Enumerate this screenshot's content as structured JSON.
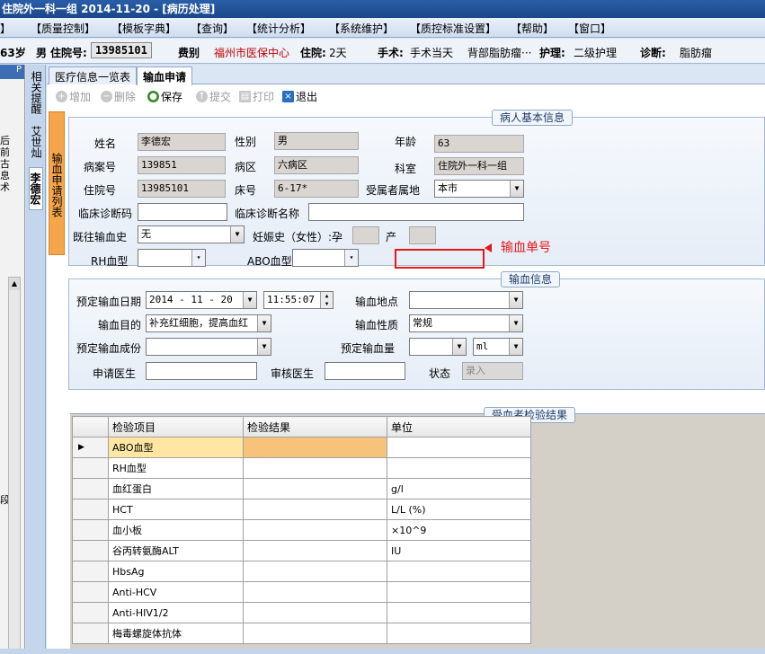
{
  "window": {
    "title": "住院外一科一组  2014-11-20 - [病历处理]"
  },
  "menu": [
    "】",
    "【质量控制】",
    "【模板字典】",
    "【查询】",
    "【统计分析】",
    "【系统维护】",
    "【质控标准设置】",
    "【帮助】",
    "【窗口】"
  ],
  "patient_bar": {
    "age": "63岁",
    "sex": "男",
    "hosp_no_label": "住院号:",
    "hosp_no": "13985101",
    "fee_label": "费别",
    "fee_value": "福州市医保中心",
    "stay_label": "住院:",
    "stay_value": "2天",
    "surgery_label": "手术:",
    "surgery_value": "手术当天",
    "surgery_detail": "背部脂肪瘤···",
    "nursing_label": "护理:",
    "nursing_value": "二级护理",
    "diagnosis_label": "诊断:",
    "diagnosis_value": "脂肪瘤"
  },
  "left_pane": {
    "pin": "P",
    "text": "后前古息术",
    "text2": "段"
  },
  "vertical_tabs": [
    "相关提醒",
    "艾世灿",
    "李德宏"
  ],
  "list_tab": "输血申请列表",
  "tabs": [
    "医疗信息一览表",
    "输血申请"
  ],
  "toolbar": {
    "add": "增加",
    "delete": "删除",
    "save": "保存",
    "submit": "提交",
    "print": "打印",
    "exit": "退出"
  },
  "basic_info": {
    "title": "病人基本信息",
    "name_label": "姓名",
    "name": "李德宏",
    "sex_label": "性别",
    "sex": "男",
    "age_label": "年龄",
    "age": "63",
    "case_no_label": "病案号",
    "case_no": "139851",
    "ward_label": "病区",
    "ward": "六病区",
    "dept_label": "科室",
    "dept": "住院外一科一组",
    "hosp_no_label": "住院号",
    "hosp_no": "13985101",
    "bed_label": "床号",
    "bed": "6-17*",
    "origin_label": "受属者属地",
    "origin": "本市",
    "diag_code_label": "临床诊断码",
    "diag_code": "",
    "diag_name_label": "临床诊断名称",
    "diag_name": "",
    "transfusion_history_label": "既往输血史",
    "transfusion_history": "无",
    "pregnancy_label": "妊娠史（女性）:孕",
    "birth_label": "产",
    "rh_label": "RH血型",
    "abo_label": "ABO血型",
    "annotation": "输血单号"
  },
  "transfusion_info": {
    "title": "输血信息",
    "date_label": "预定输血日期",
    "date": "2014 - 11 - 20",
    "time": "11:55:07",
    "location_label": "输血地点",
    "purpose_label": "输血目的",
    "purpose": "补充红细胞，提高血红",
    "nature_label": "输血性质",
    "nature": "常规",
    "component_label": "预定输血成份",
    "amount_label": "预定输血量",
    "unit": "ml",
    "doctor_label": "申请医生",
    "reviewer_label": "审核医生",
    "status_label": "状态",
    "status": "录入"
  },
  "lab_results": {
    "title": "受血者检验结果",
    "columns": [
      "检验项目",
      "检验结果",
      "单位"
    ],
    "rows": [
      {
        "item": "ABO血型",
        "result": "",
        "unit": ""
      },
      {
        "item": "RH血型",
        "result": "",
        "unit": ""
      },
      {
        "item": "血红蛋白",
        "result": "",
        "unit": "g/l"
      },
      {
        "item": "HCT",
        "result": "",
        "unit": "L/L (%)"
      },
      {
        "item": "血小板",
        "result": "",
        "unit": "×10^9"
      },
      {
        "item": "谷丙转氨酶ALT",
        "result": "",
        "unit": "IU"
      },
      {
        "item": "HbsAg",
        "result": "",
        "unit": ""
      },
      {
        "item": "Anti-HCV",
        "result": "",
        "unit": ""
      },
      {
        "item": "Anti-HIV1/2",
        "result": "",
        "unit": ""
      },
      {
        "item": "梅毒螺旋体抗体",
        "result": "",
        "unit": ""
      }
    ]
  },
  "colors": {
    "accent_red": "#e81818",
    "fee_red": "#c00000",
    "selected_row": "#ffe7a3"
  }
}
